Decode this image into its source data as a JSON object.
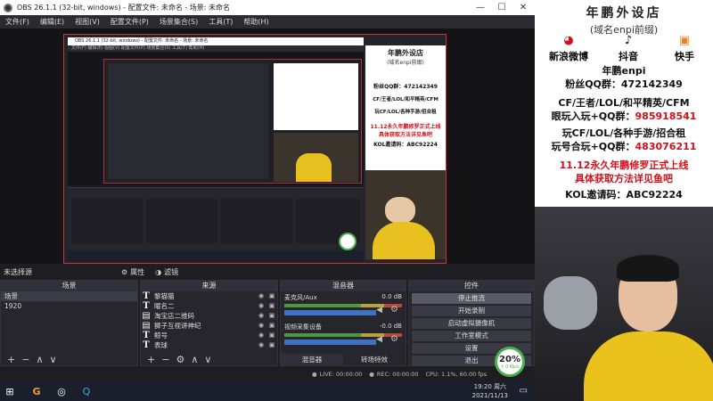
{
  "window": {
    "title": "OBS 26.1.1 (32-bit, windows) - 配置文件: 未命名 - 场景: 未命名",
    "menu": [
      "文件(F)",
      "编辑(E)",
      "视图(V)",
      "配置文件(P)",
      "场景集合(S)",
      "工具(T)",
      "帮助(H)"
    ]
  },
  "inner": {
    "title": "OBS 26.1.1 (32-bit, windows) - 配置文件: 未命名 - 场景: 未命名",
    "menu": "文件(F) 编辑(E) 视图(V) 配置文件(P) 场景集合(S) 工具(T) 帮助(H)"
  },
  "preview": {
    "source_label": "未选择源",
    "properties_label": "属性",
    "filters_label": "滤镜"
  },
  "docks": {
    "scenes_title": "场景",
    "sources_title": "来源",
    "mixer_title": "混音器",
    "controls_title": "控件",
    "scenes": [
      "场景",
      "1920"
    ],
    "sources": [
      "黎猫猫",
      "曜名二",
      "淘宝店二维码",
      "狮子互视讲神纪",
      "鲸号",
      "表球"
    ],
    "mixer": [
      {
        "name": "麦克风/Aux",
        "db": "0.0 dB"
      },
      {
        "name": "视频采集设备",
        "db": "-0.0 dB"
      }
    ],
    "mixer_tabs": [
      "混音器",
      "转场特效"
    ],
    "controls": [
      "停止推流",
      "开始录制",
      "启动虚拟摄像机",
      "工作室模式",
      "设置",
      "退出"
    ]
  },
  "status": {
    "live": "LIVE: 00:00:00",
    "rec": "REC: 00:00:00",
    "cpu": "CPU: 1.1%, 60.00 fps",
    "kbps": "kb/s"
  },
  "cpu_widget": {
    "percent": "20%",
    "rate": "↑ 0 Kb/s"
  },
  "taskbar": {
    "time": "19:20 周六",
    "date": "2021/11/13"
  },
  "overlay": {
    "title": "年鹏外设店",
    "subtitle": "(域名enpi前缀)",
    "social": [
      {
        "icon": "weibo-icon",
        "label": "新浪微博"
      },
      {
        "icon": "douyin-icon",
        "label": "抖音"
      },
      {
        "icon": "kuaishou-icon",
        "label": "快手"
      }
    ],
    "line1": "年鹏enpi",
    "line2": "粉丝QQ群：472142349",
    "line3": "CF/王者/LOL/和平精英/CFM",
    "line4a": "眼玩入玩+QQ群：",
    "line4b": "985918541",
    "line5": "玩CF/LOL/各种手游/招合租",
    "line6a": "玩号合玩+QQ群：",
    "line6b": "483076211",
    "line7": "11.12永久年鹏修罗正式上线",
    "line8": "具体获取方法详见鱼吧",
    "line9": "KOL邀请码：ABC92224"
  },
  "colors": {
    "accent_red": "#d0101a",
    "obs_bg": "#1d1d22",
    "cpu_green": "#4cb050"
  }
}
